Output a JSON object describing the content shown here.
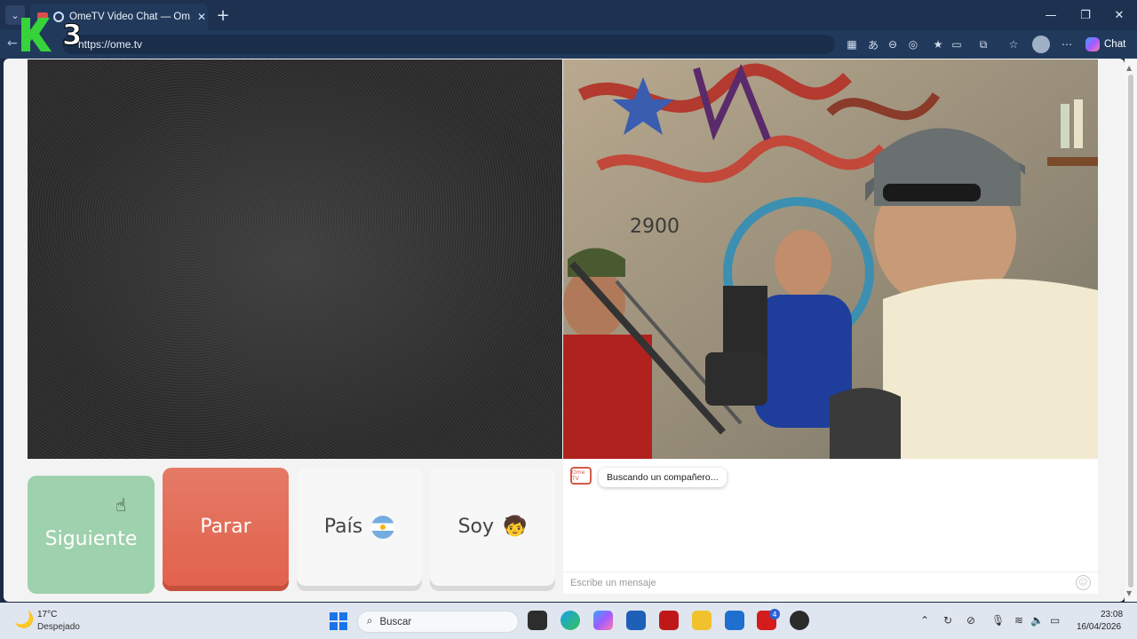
{
  "browser": {
    "tab_title": "OmeTV Video Chat — Omegle",
    "url": "https://ome.tv",
    "chat_label": "Chat",
    "colors": {
      "chrome": "#1f3150",
      "addrbar": "#213a5c"
    }
  },
  "overlay_logo": {
    "text": "3"
  },
  "controls": {
    "next_label": "Siguiente",
    "stop_label": "Parar",
    "country_label": "País",
    "iam_label": "Soy",
    "country_icon": "argentina-flag-icon",
    "iam_icon": "face-icon",
    "colors": {
      "next": "#9ed1ad",
      "stop": "#e2624c"
    }
  },
  "chat": {
    "status_message": "Buscando un compañero...",
    "tv_icon_text": "Ome TV",
    "input_placeholder": "Escribe un mensaje"
  },
  "taskbar": {
    "temperature": "17°C",
    "weather": "Despejado",
    "search_label": "Buscar",
    "badge_count": "4",
    "time": "23:08",
    "date": "16/04/2026"
  }
}
